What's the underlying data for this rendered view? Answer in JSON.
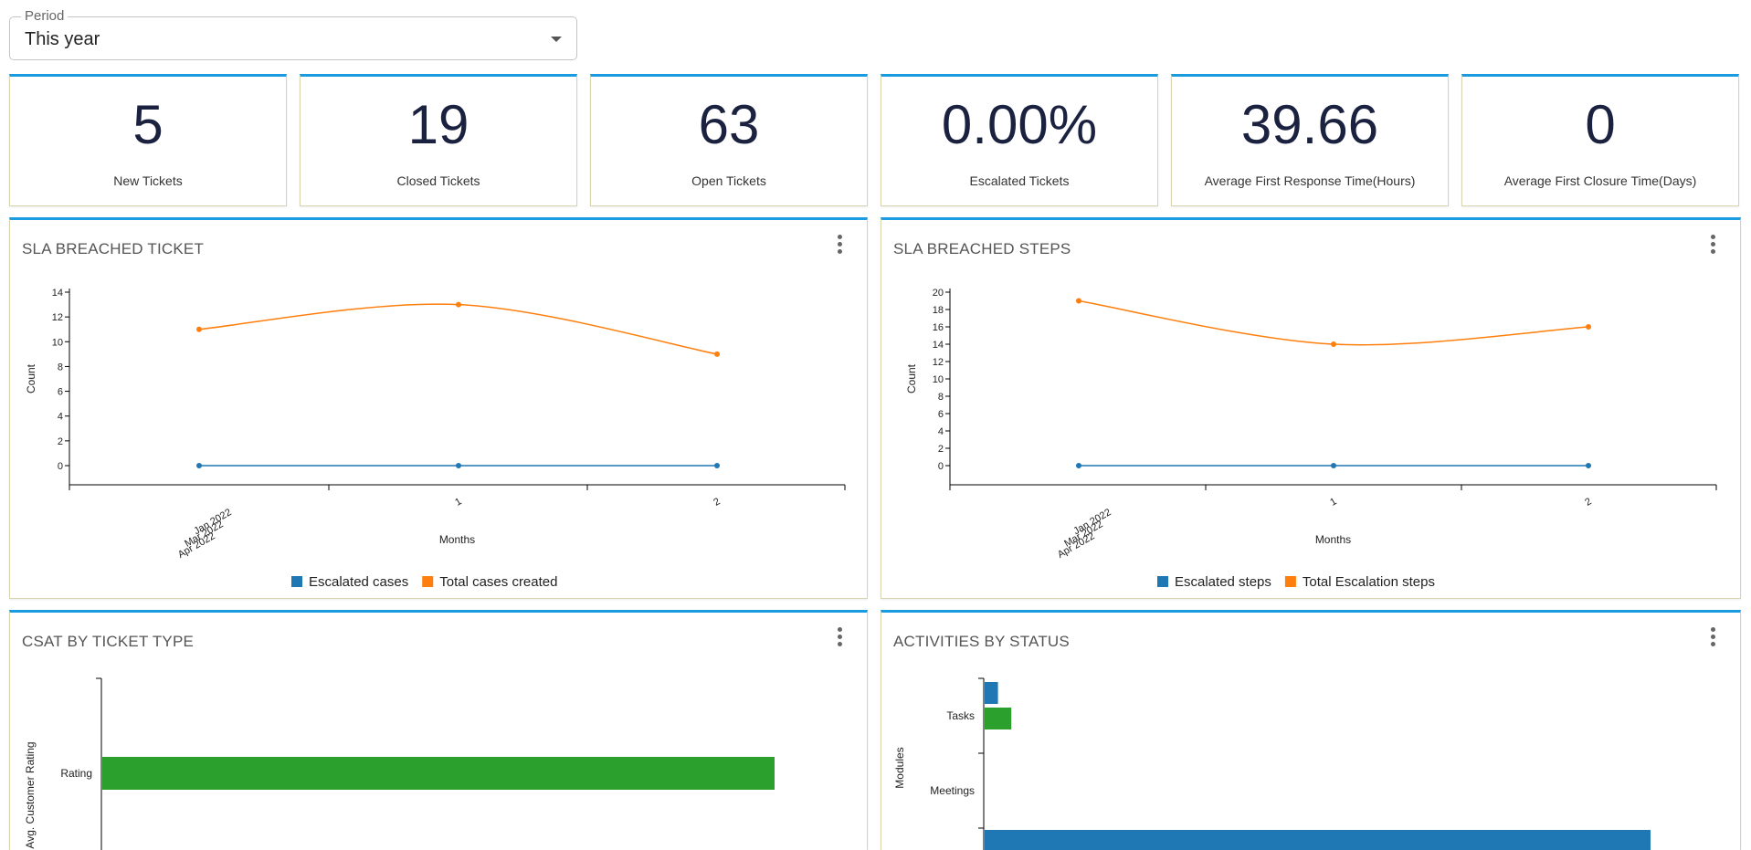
{
  "period": {
    "label": "Period",
    "value": "This year"
  },
  "kpis": [
    {
      "value": "5",
      "label": "New Tickets"
    },
    {
      "value": "19",
      "label": "Closed Tickets"
    },
    {
      "value": "63",
      "label": "Open Tickets"
    },
    {
      "value": "0.00%",
      "label": "Escalated Tickets"
    },
    {
      "value": "39.66",
      "label": "Average First Response Time(Hours)"
    },
    {
      "value": "0",
      "label": "Average First Closure Time(Days)"
    }
  ],
  "cards": {
    "sla_ticket": {
      "title": "SLA BREACHED TICKET"
    },
    "sla_steps": {
      "title": "SLA BREACHED STEPS"
    },
    "csat": {
      "title": "CSAT BY TICKET TYPE"
    },
    "activities": {
      "title": "ACTIVITIES BY STATUS"
    }
  },
  "chart_data": [
    {
      "type": "line",
      "title": "SLA BREACHED TICKET",
      "xlabel": "Months",
      "ylabel": "Count",
      "x": [
        "Jan 2022 Mar 2022 Apr 2022",
        "1",
        "2"
      ],
      "ylim": [
        0,
        14
      ],
      "yticks": [
        0,
        2,
        4,
        6,
        8,
        10,
        12,
        14
      ],
      "series": [
        {
          "name": "Escalated cases",
          "color": "#1f77b4",
          "values": [
            0,
            0,
            0
          ]
        },
        {
          "name": "Total cases created",
          "color": "#ff7f0e",
          "values": [
            11,
            13,
            9
          ]
        }
      ],
      "legend": "bottom"
    },
    {
      "type": "line",
      "title": "SLA BREACHED STEPS",
      "xlabel": "Months",
      "ylabel": "Count",
      "x": [
        "Jan 2022 Mar 2022 Apr 2022",
        "1",
        "2"
      ],
      "ylim": [
        0,
        20
      ],
      "yticks": [
        0,
        2,
        4,
        6,
        8,
        10,
        12,
        14,
        16,
        18,
        20
      ],
      "series": [
        {
          "name": "Escalated steps",
          "color": "#1f77b4",
          "values": [
            0,
            0,
            0
          ]
        },
        {
          "name": "Total Escalation steps",
          "color": "#ff7f0e",
          "values": [
            19,
            14,
            16
          ]
        }
      ],
      "legend": "bottom"
    },
    {
      "type": "bar",
      "orientation": "horizontal",
      "title": "CSAT BY TICKET TYPE",
      "ylabel": "Avg. Customer Rating",
      "categories": [
        "Rating"
      ],
      "series": [
        {
          "color": "#2ca02c",
          "values": [
            1
          ]
        }
      ]
    },
    {
      "type": "bar",
      "orientation": "horizontal",
      "title": "ACTIVITIES BY STATUS",
      "ylabel": "Modules",
      "categories": [
        "Tasks",
        "Meetings"
      ],
      "bars": [
        {
          "category": "Tasks",
          "color": "#1f77b4",
          "value": 0.02
        },
        {
          "category": "Tasks",
          "color": "#2ca02c",
          "value": 0.04
        },
        {
          "category": "Meetings",
          "color": "#1f77b4",
          "value": 1
        }
      ]
    }
  ]
}
